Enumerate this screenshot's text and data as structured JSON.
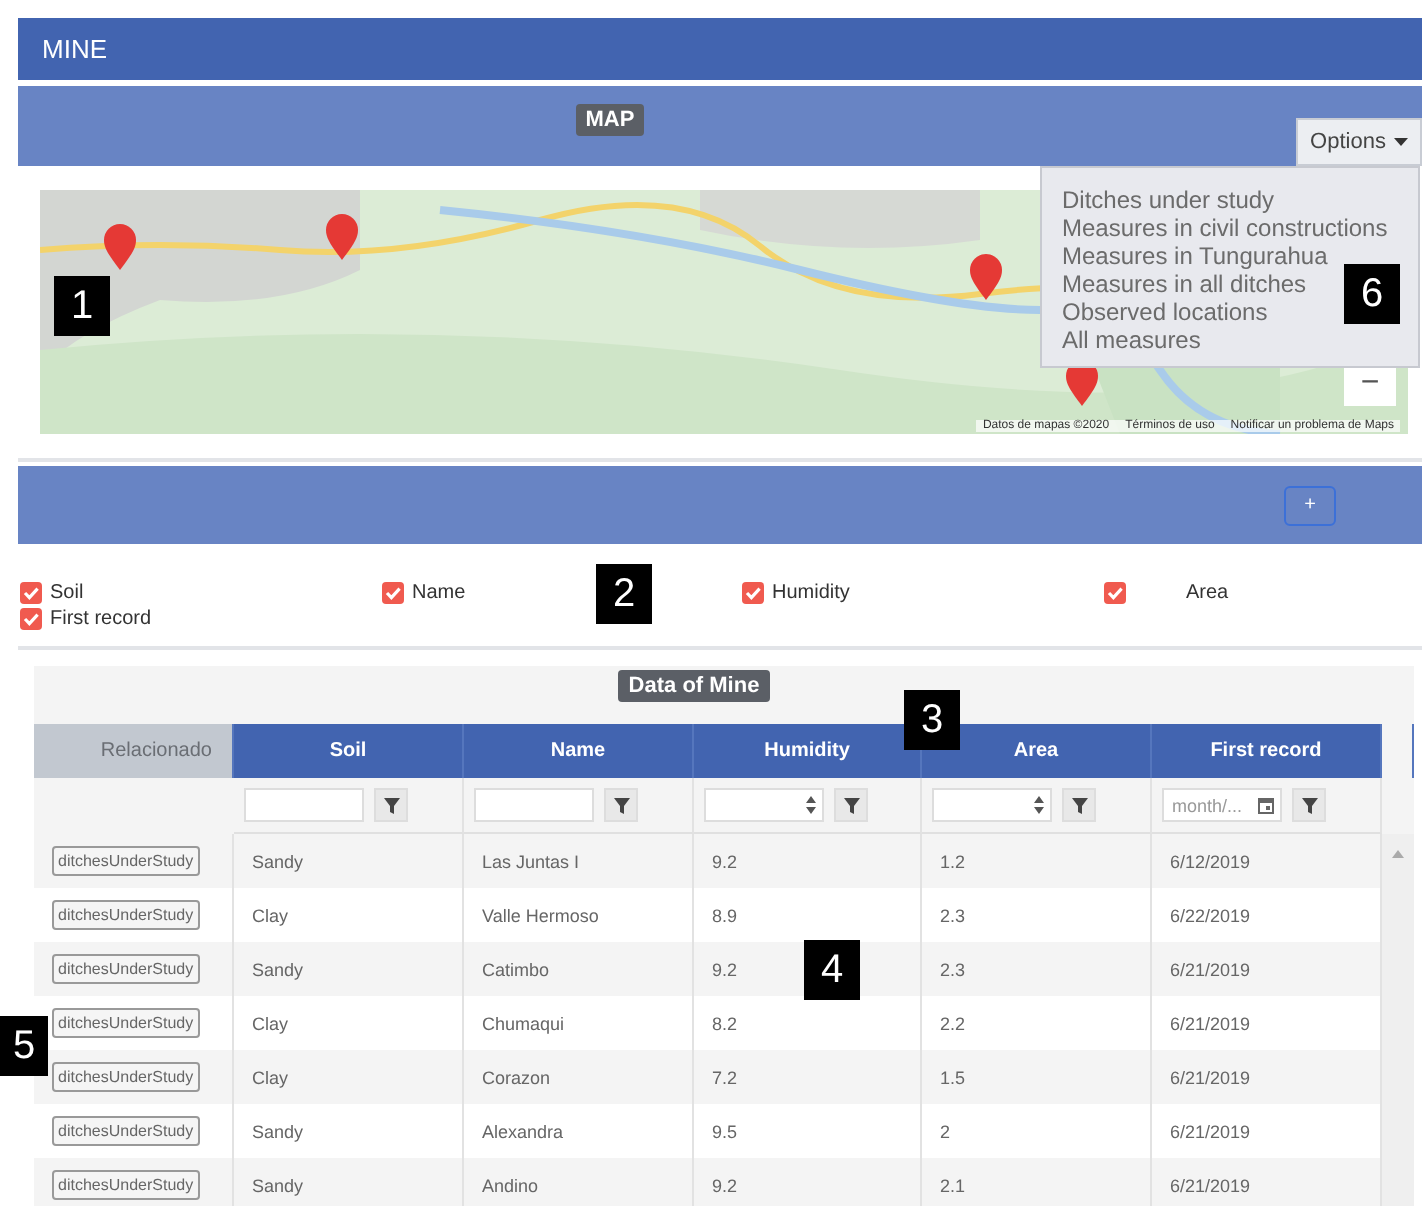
{
  "header": {
    "title": "MINE"
  },
  "map_panel": {
    "badge": "MAP",
    "options_button": "Options",
    "options_menu": [
      "Ditches under study",
      "Measures in civil constructions",
      "Measures in Tungurahua",
      "Measures in all ditches",
      "Observed locations",
      "All measures"
    ],
    "map": {
      "kind": "picture",
      "zoom_button": "−",
      "attribution": [
        "Datos de mapas ©2020",
        "Términos de uso",
        "Notificar un problema de Maps"
      ]
    }
  },
  "toolbar": {
    "add_button": "+"
  },
  "column_toggles": [
    {
      "label": "Soil",
      "checked": true
    },
    {
      "label": "Name",
      "checked": true
    },
    {
      "label": "Humidity",
      "checked": true
    },
    {
      "label": "Area",
      "checked": true
    },
    {
      "label": "First record",
      "checked": true
    }
  ],
  "table": {
    "title": "Data of Mine",
    "columns": [
      {
        "label": "Relacionado",
        "kind": "related"
      },
      {
        "label": "Soil",
        "kind": "data"
      },
      {
        "label": "Name",
        "kind": "data"
      },
      {
        "label": "Humidity",
        "kind": "data"
      },
      {
        "label": "Area",
        "kind": "data"
      },
      {
        "label": "First record",
        "kind": "data"
      }
    ],
    "filters": [
      {
        "kind": "none"
      },
      {
        "kind": "text"
      },
      {
        "kind": "text"
      },
      {
        "kind": "number"
      },
      {
        "kind": "number"
      },
      {
        "kind": "date",
        "placeholder": "month/..."
      }
    ],
    "rows": [
      {
        "related": "ditchesUnderStudy",
        "cells": [
          "Sandy",
          "Las Juntas I",
          "9.2",
          "1.2",
          "6/12/2019"
        ]
      },
      {
        "related": "ditchesUnderStudy",
        "cells": [
          "Clay",
          "Valle Hermoso",
          "8.9",
          "2.3",
          "6/22/2019"
        ]
      },
      {
        "related": "ditchesUnderStudy",
        "cells": [
          "Sandy",
          "Catimbo",
          "9.2",
          "2.3",
          "6/21/2019"
        ]
      },
      {
        "related": "ditchesUnderStudy",
        "cells": [
          "Clay",
          "Chumaqui",
          "8.2",
          "2.2",
          "6/21/2019"
        ]
      },
      {
        "related": "ditchesUnderStudy",
        "cells": [
          "Clay",
          "Corazon",
          "7.2",
          "1.5",
          "6/21/2019"
        ]
      },
      {
        "related": "ditchesUnderStudy",
        "cells": [
          "Sandy",
          "Alexandra",
          "9.5",
          "2",
          "6/21/2019"
        ]
      },
      {
        "related": "ditchesUnderStudy",
        "cells": [
          "Sandy",
          "Andino",
          "9.2",
          "2.1",
          "6/21/2019"
        ]
      }
    ]
  },
  "callouts": [
    "1",
    "2",
    "3",
    "4",
    "5",
    "6"
  ]
}
